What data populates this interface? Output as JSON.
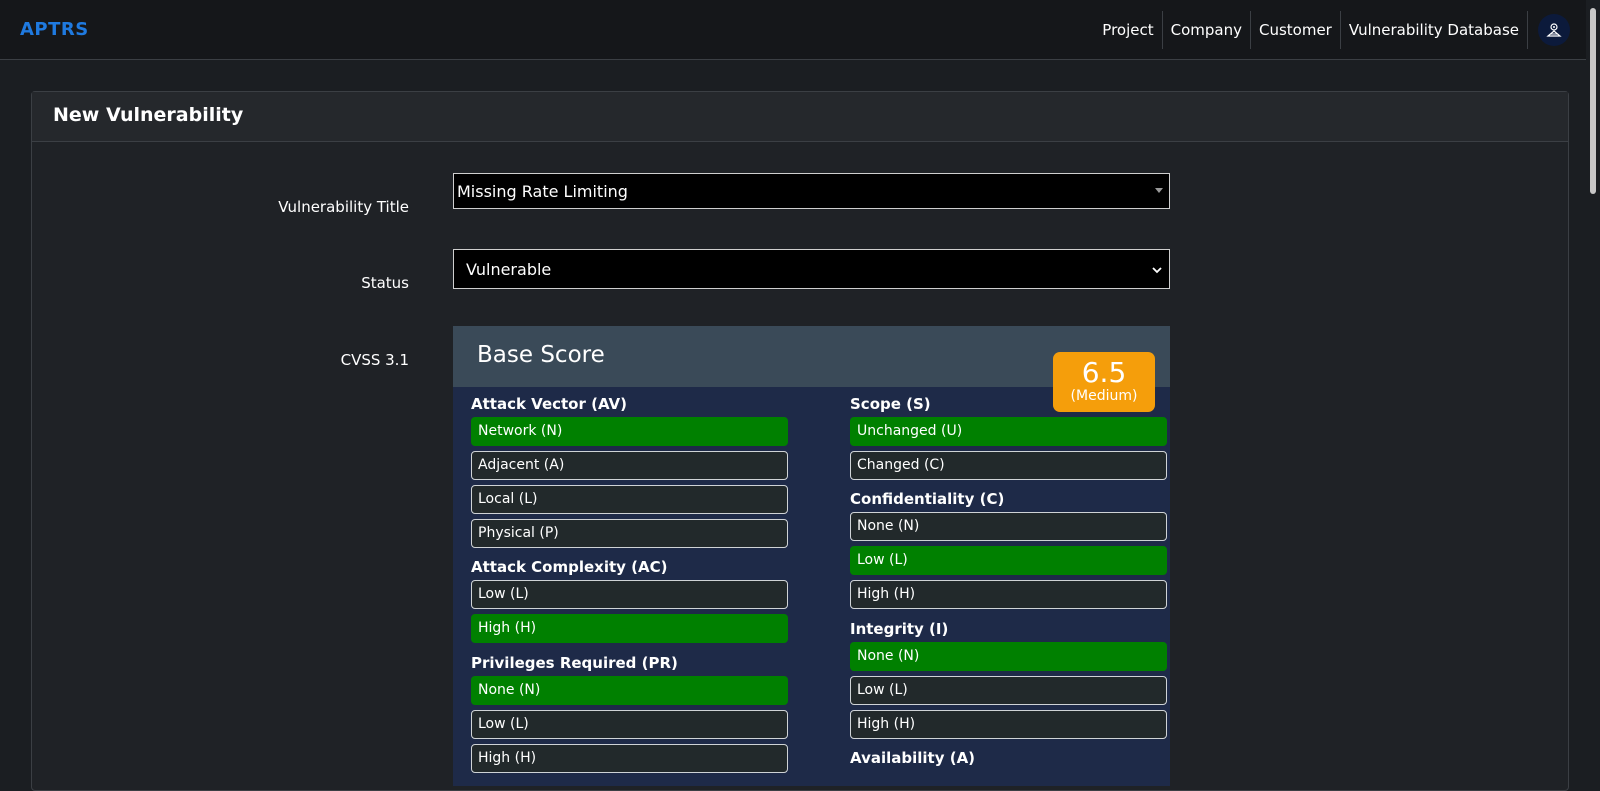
{
  "navbar": {
    "brand": "APTRS",
    "items": [
      "Project",
      "Company",
      "Customer",
      "Vulnerability Database"
    ]
  },
  "card": {
    "title": "New Vulnerability"
  },
  "form": {
    "title_label": "Vulnerability Title",
    "title_value": "Missing Rate Limiting",
    "status_label": "Status",
    "status_value": "Vulnerable",
    "cvss_label": "CVSS 3.1"
  },
  "cvss": {
    "header": "Base Score",
    "score": "6.5",
    "severity": "(Medium)",
    "severity_color": "#f59e0b",
    "selected_color": "#008000",
    "attack_vector": {
      "title": "Attack Vector (AV)",
      "options": [
        "Network (N)",
        "Adjacent (A)",
        "Local (L)",
        "Physical (P)"
      ],
      "selected": "Network (N)"
    },
    "attack_complexity": {
      "title": "Attack Complexity (AC)",
      "options": [
        "Low (L)",
        "High (H)"
      ],
      "selected": "High (H)"
    },
    "privileges_required": {
      "title": "Privileges Required (PR)",
      "options": [
        "None (N)",
        "Low (L)",
        "High (H)"
      ],
      "selected": "None (N)"
    },
    "scope": {
      "title": "Scope (S)",
      "options": [
        "Unchanged (U)",
        "Changed (C)"
      ],
      "selected": "Unchanged (U)"
    },
    "confidentiality": {
      "title": "Confidentiality (C)",
      "options": [
        "None (N)",
        "Low (L)",
        "High (H)"
      ],
      "selected": "Low (L)"
    },
    "integrity": {
      "title": "Integrity (I)",
      "options": [
        "None (N)",
        "Low (L)",
        "High (H)"
      ],
      "selected": "None (N)"
    },
    "availability": {
      "title": "Availability (A)"
    }
  }
}
